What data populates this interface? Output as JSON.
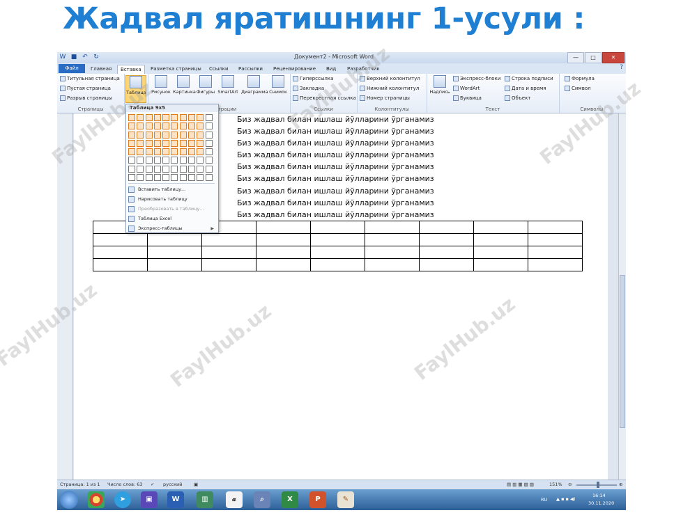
{
  "slide_title": "Жадвал яратишнинг 1-усули :",
  "window": {
    "title": "Документ2 - Microsoft Word",
    "controls": [
      "—",
      "□",
      "✕"
    ]
  },
  "tabs": {
    "file": "Файл",
    "items": [
      "Главная",
      "Вставка",
      "Разметка страницы",
      "Ссылки",
      "Рассылки",
      "Рецензирование",
      "Вид",
      "Разработчик"
    ]
  },
  "ribbon": {
    "pages": {
      "items": [
        "Титульная страница",
        "Пустая страница",
        "Разрыв страницы"
      ],
      "label": "Страницы"
    },
    "tables": {
      "button": "Таблица"
    },
    "illustrations": {
      "buttons": [
        "Рисунок",
        "Картинка",
        "Фигуры",
        "SmartArt",
        "Диаграмма",
        "Снимок"
      ],
      "label": "Иллюстрации"
    },
    "links": {
      "items": [
        "Гиперссылка",
        "Закладка",
        "Перекрестная ссылка"
      ],
      "label": "Ссылки"
    },
    "header_footer": {
      "items": [
        "Верхний колонтитул",
        "Нижний колонтитул",
        "Номер страницы"
      ],
      "label": "Колонтитулы"
    },
    "text": {
      "big_button": "Надпись",
      "items": [
        "Экспресс-блоки",
        "WordArt",
        "Буквица"
      ],
      "items2": [
        "Строка подписи",
        "Дата и время",
        "Объект"
      ],
      "label": "Текст"
    },
    "symbols": {
      "items": [
        "Формула",
        "Символ"
      ],
      "label": "Символы"
    }
  },
  "table_dropdown": {
    "header": "Таблица 9x5",
    "grid_cols": 10,
    "grid_rows": 8,
    "selected_cols": 9,
    "selected_rows": 5,
    "items": [
      {
        "label": "Вставить таблицу...",
        "disabled": false
      },
      {
        "label": "Нарисовать таблицу",
        "disabled": false
      },
      {
        "label": "Преобразовать в таблицу...",
        "disabled": true
      },
      {
        "label": "Таблица Excel",
        "disabled": false
      },
      {
        "label": "Экспресс-таблицы",
        "disabled": false,
        "submenu": true
      }
    ]
  },
  "document": {
    "lines": [
      "Биз жадвал билан ишлаш йўлларини ўрганамиз",
      "Биз жадвал билан ишлаш йўлларини ўрганамиз",
      "Биз жадвал билан ишлаш йўлларини ўрганамиз",
      "Биз жадвал билан ишлаш йўлларини ўрганамиз",
      "Биз жадвал билан ишлаш йўлларини ўрганамиз",
      "Биз жадвал билан ишлаш йўлларини ўрганамиз",
      "Биз жадвал билан ишлаш йўлларини ўрганамиз",
      "Биз жадвал билан ишлаш йўлларини ўрганамиз",
      "Биз жадвал билан ишлаш йўлларини ўрганамиз"
    ],
    "table": {
      "rows": 4,
      "cols": 9
    }
  },
  "status_bar": {
    "page": "Страница: 1 из 1",
    "words": "Число слов: 63",
    "language": "русский",
    "zoom": "151%"
  },
  "taskbar": {
    "apps": [
      "chrome-icon",
      "telegram-icon",
      "save-icon",
      "word-icon",
      "books-icon",
      "font-icon",
      "search-tool-icon",
      "excel-icon",
      "powerpoint-icon",
      "paint-icon"
    ],
    "tray_lang": "RU",
    "time": "16:14",
    "date": "30.11.2020"
  },
  "watermark": "FaylHub.uz"
}
